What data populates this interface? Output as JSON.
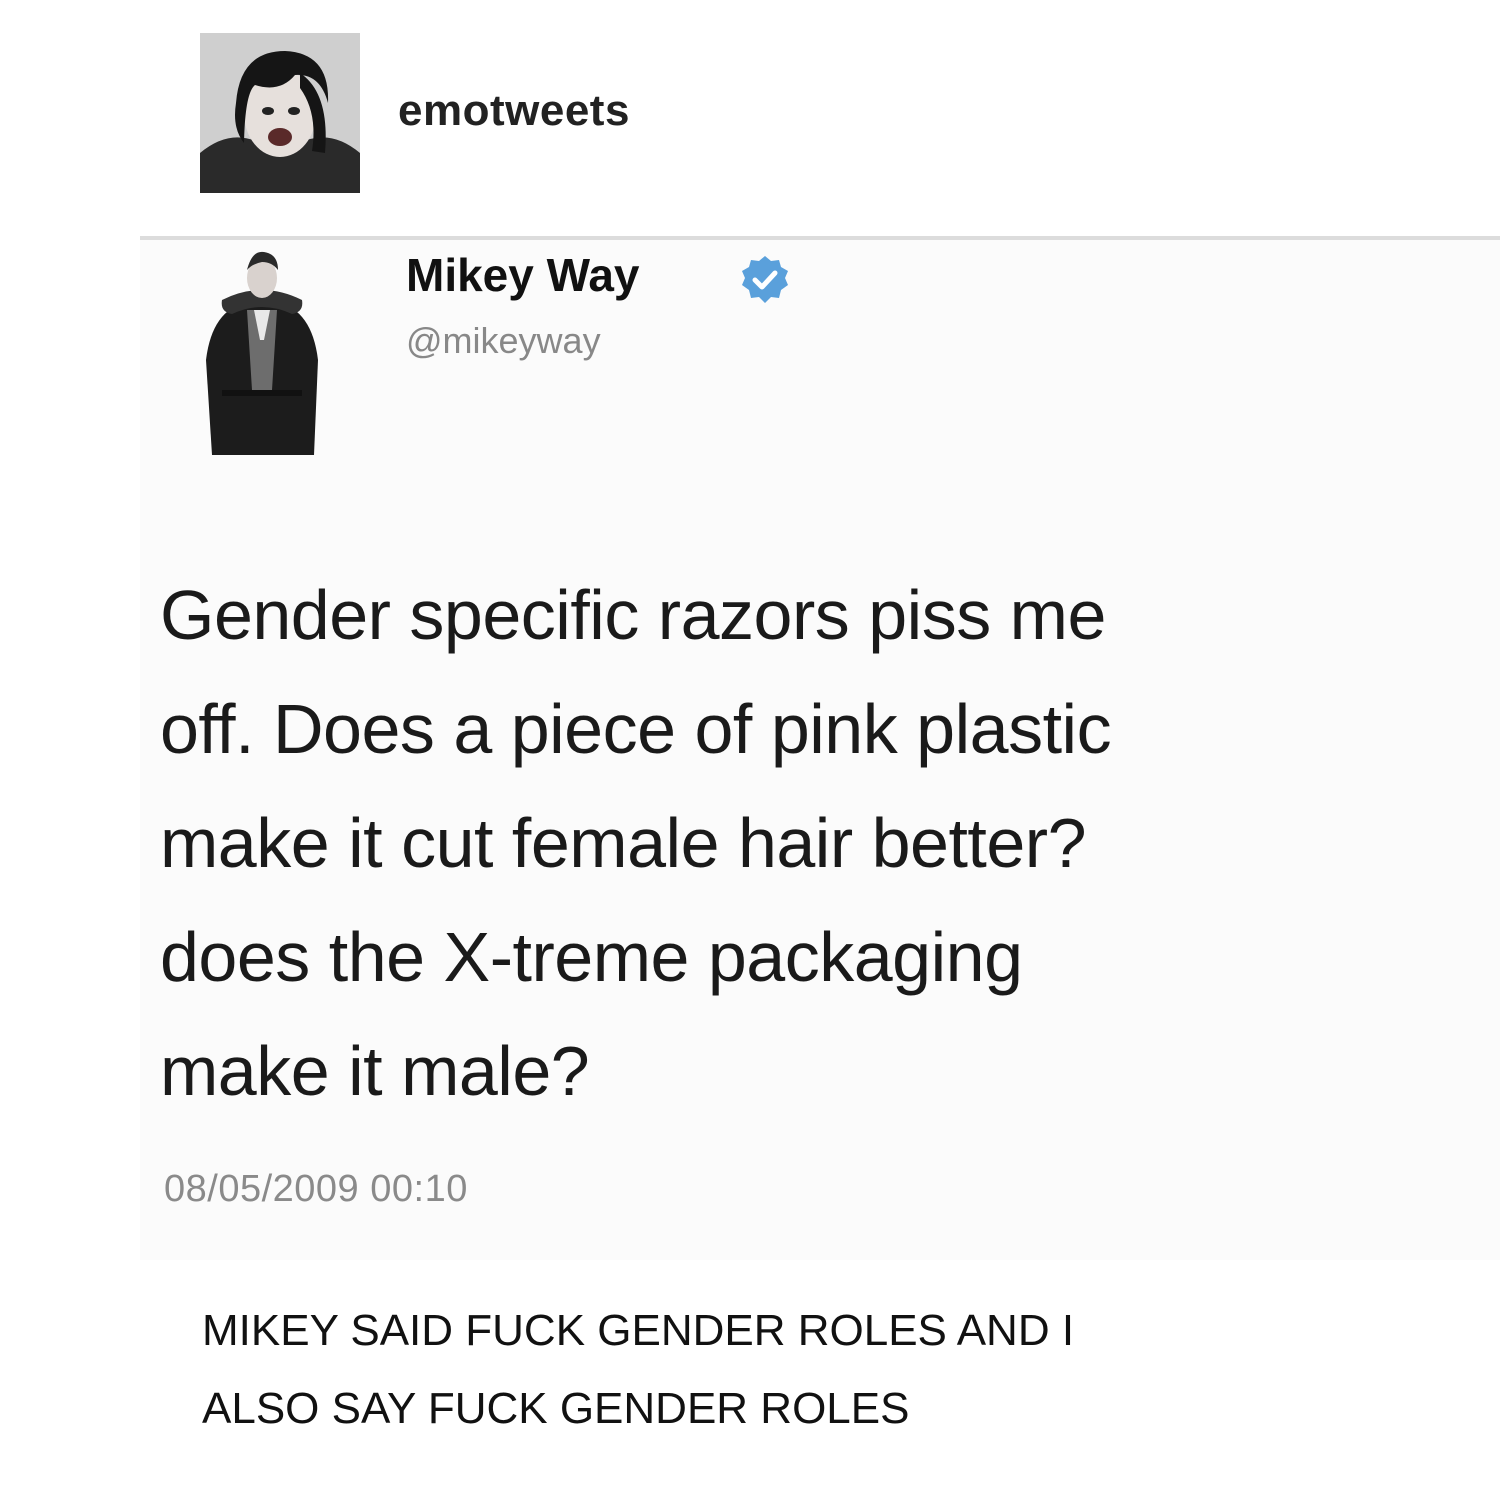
{
  "post": {
    "username": "emotweets",
    "avatar_icon": "profile-photo-icon"
  },
  "tweet": {
    "display_name": "Mikey Way",
    "verified_icon": "verified-badge-icon",
    "verified_color": "#5aa0db",
    "handle": "@mikeyway",
    "avatar_icon": "profile-photo-icon",
    "text_lines": [
      "Gender specific razors piss me",
      "off. Does a piece of pink plastic",
      "make it cut female hair better?",
      "does the X-treme packaging",
      "make it male?"
    ],
    "timestamp": "08/05/2009 00:10"
  },
  "caption": {
    "lines": [
      "MIKEY SAID FUCK GENDER ROLES AND I",
      "ALSO SAY FUCK GENDER ROLES"
    ]
  }
}
